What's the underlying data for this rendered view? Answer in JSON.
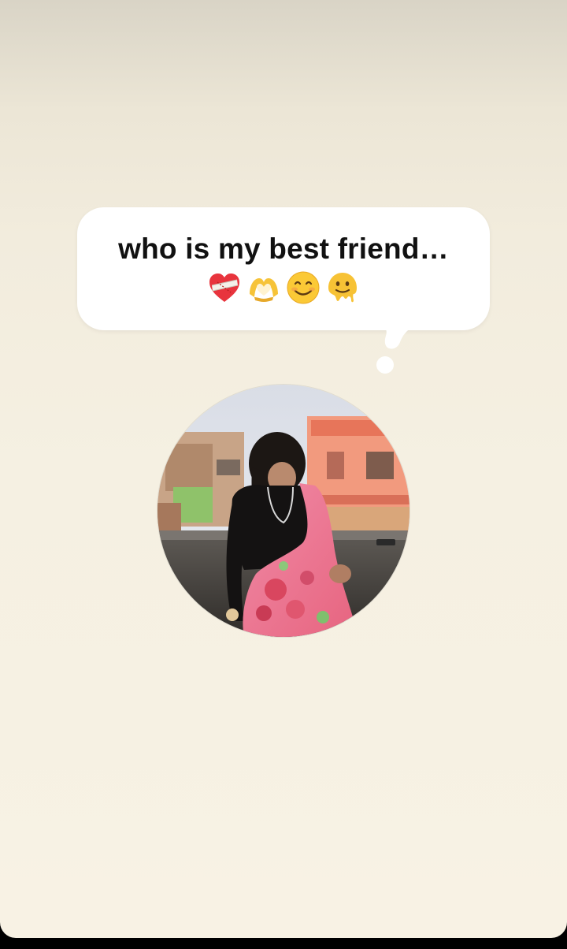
{
  "note": {
    "text": "who is my best friend…",
    "emojis": [
      "mending-heart-emoji",
      "heart-hands-emoji",
      "smiling-face-emoji",
      "melting-face-emoji"
    ]
  },
  "avatar": {
    "description": "profile-photo"
  },
  "colors": {
    "background_top": "#d9d4c6",
    "background_bottom": "#f8f2e4",
    "bubble": "#ffffff",
    "text": "#111111"
  }
}
